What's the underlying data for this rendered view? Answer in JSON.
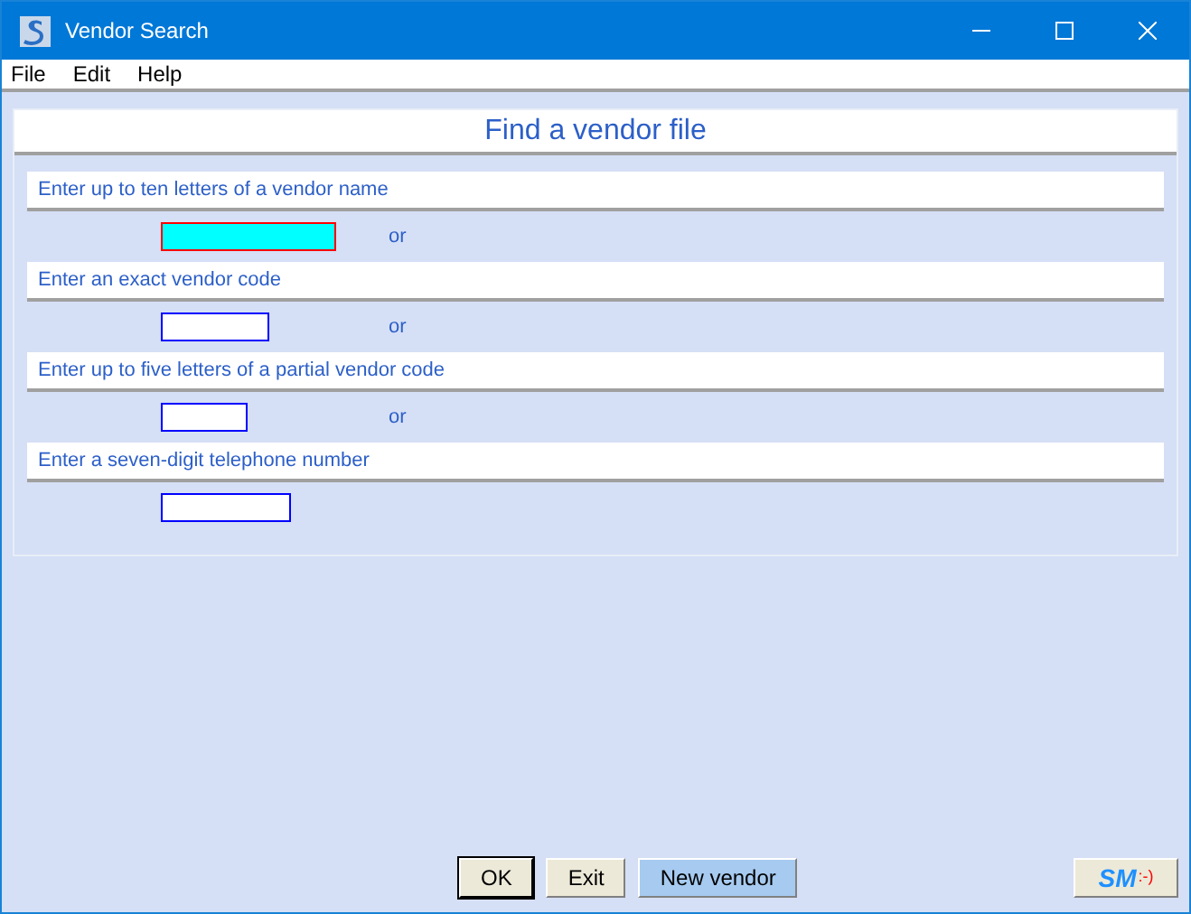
{
  "window": {
    "title": "Vendor Search"
  },
  "menu": [
    "File",
    "Edit",
    "Help"
  ],
  "panel": {
    "heading": "Find a vendor file",
    "fields": [
      {
        "prompt": "Enter up to ten letters of a vendor name",
        "kind": "long",
        "focused": true,
        "separator": "or"
      },
      {
        "prompt": "Enter an exact vendor code",
        "kind": "medium",
        "focused": false,
        "separator": "or"
      },
      {
        "prompt": "Enter up to five letters of a partial vendor code",
        "kind": "short",
        "focused": false,
        "separator": "or"
      },
      {
        "prompt": "Enter a seven-digit telephone number",
        "kind": "phone",
        "focused": false
      }
    ]
  },
  "buttons": [
    {
      "label": "OK",
      "default": true,
      "highlighted": false
    },
    {
      "label": "Exit",
      "default": false,
      "highlighted": false
    },
    {
      "label": "New vendor",
      "default": false,
      "highlighted": true
    }
  ],
  "logo_button": {
    "letters": "SM",
    "smiley": ":-)"
  }
}
